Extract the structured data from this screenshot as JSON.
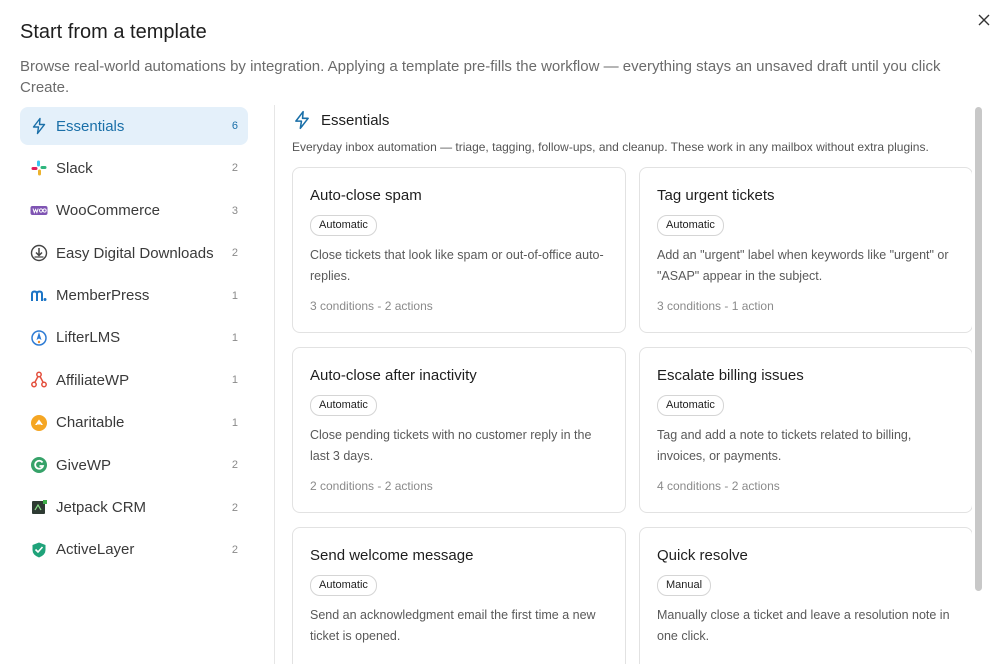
{
  "header": {
    "title": "Start from a template",
    "description": "Browse real-world automations by integration. Applying a template pre-fills the workflow — everything stays an unsaved draft until you click Create."
  },
  "sidebar": {
    "items": [
      {
        "label": "Essentials",
        "count": "6",
        "icon": "lightning-icon",
        "active": true
      },
      {
        "label": "Slack",
        "count": "2",
        "icon": "slack-icon"
      },
      {
        "label": "WooCommerce",
        "count": "3",
        "icon": "woocommerce-icon"
      },
      {
        "label": "Easy Digital Downloads",
        "count": "2",
        "icon": "edd-icon"
      },
      {
        "label": "MemberPress",
        "count": "1",
        "icon": "memberpress-icon"
      },
      {
        "label": "LifterLMS",
        "count": "1",
        "icon": "lifterlms-icon"
      },
      {
        "label": "AffiliateWP",
        "count": "1",
        "icon": "affiliatewp-icon"
      },
      {
        "label": "Charitable",
        "count": "1",
        "icon": "charitable-icon"
      },
      {
        "label": "GiveWP",
        "count": "2",
        "icon": "givewp-icon"
      },
      {
        "label": "Jetpack CRM",
        "count": "2",
        "icon": "jetpack-crm-icon"
      },
      {
        "label": "ActiveLayer",
        "count": "2",
        "icon": "activelayer-icon"
      }
    ]
  },
  "section": {
    "title": "Essentials",
    "description": "Everyday inbox automation — triage, tagging, follow-ups, and cleanup. These work in any mailbox without extra plugins."
  },
  "cards": [
    {
      "title": "Auto-close spam",
      "badge": "Automatic",
      "description": "Close tickets that look like spam or out-of-office auto-replies.",
      "meta": "3 conditions - 2 actions"
    },
    {
      "title": "Tag urgent tickets",
      "badge": "Automatic",
      "description": "Add an \"urgent\" label when keywords like \"urgent\" or \"ASAP\" appear in the subject.",
      "meta": "3 conditions - 1 action"
    },
    {
      "title": "Auto-close after inactivity",
      "badge": "Automatic",
      "description": "Close pending tickets with no customer reply in the last 3 days.",
      "meta": "2 conditions - 2 actions"
    },
    {
      "title": "Escalate billing issues",
      "badge": "Automatic",
      "description": "Tag and add a note to tickets related to billing, invoices, or payments.",
      "meta": "4 conditions - 2 actions"
    },
    {
      "title": "Send welcome message",
      "badge": "Automatic",
      "description": "Send an acknowledgment email the first time a new ticket is opened.",
      "meta": ""
    },
    {
      "title": "Quick resolve",
      "badge": "Manual",
      "description": "Manually close a ticket and leave a resolution note in one click.",
      "meta": ""
    }
  ],
  "colors": {
    "accent": "#1a6fa8",
    "active_bg": "#e4f0fa"
  }
}
